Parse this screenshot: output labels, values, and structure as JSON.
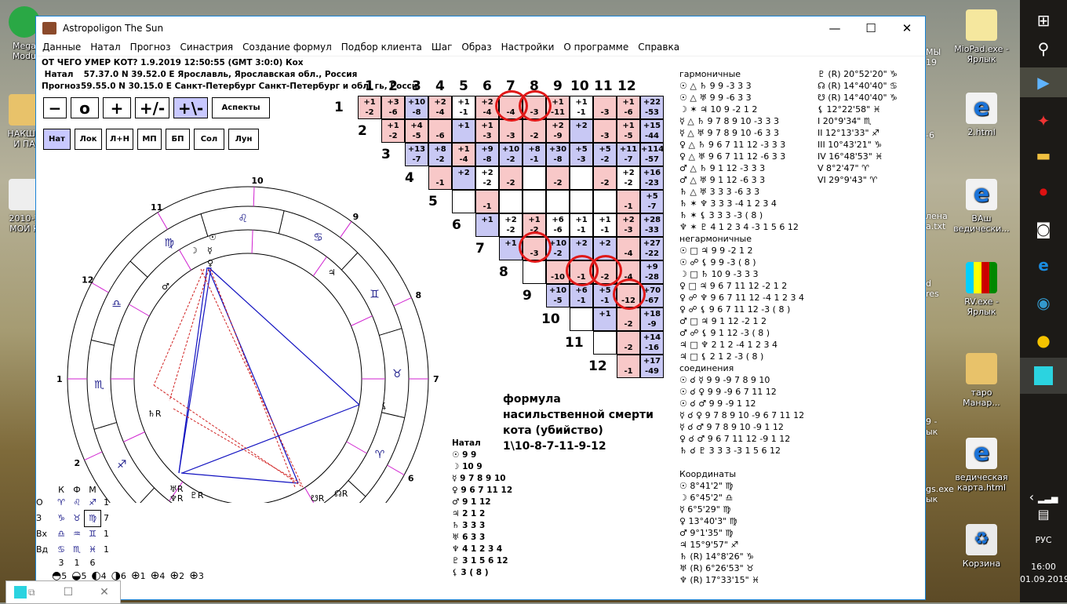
{
  "desktop": {
    "left_icons": [
      {
        "label": "Mega\nModu",
        "color": "#2aa845"
      },
      {
        "label": "НАКША\nИ ПА",
        "color": "#e8c26a"
      },
      {
        "label": "2010-2\nМОЙ К",
        "color": "#eeeeee"
      }
    ],
    "right_icons": [
      {
        "label": "MioPad.exe -\nЯрлык",
        "color": "#f5e79e"
      },
      {
        "label": "2.html",
        "color": "#f2f2f2"
      },
      {
        "label": "ВАш\nведически...",
        "color": "#f2f2f2"
      },
      {
        "label": "RV.exe -\nЯрлык",
        "color": "#d81c1c"
      },
      {
        "label": "таро\nМанар...",
        "color": "#e8c26a"
      },
      {
        "label": "ведическая\nкарта.html",
        "color": "#f2f2f2"
      },
      {
        "label": "Корзина",
        "color": "#eaeaea"
      }
    ],
    "partial_icons": [
      "МЫ\n19",
      "-6",
      "лена\na.txt",
      "d\nres",
      "9 -\nык",
      "gs.exe\nык"
    ]
  },
  "taskbar": {
    "language": "РУС",
    "time": "16:00",
    "date": "01.09.2019",
    "items": [
      "windows-start",
      "search",
      "media-player",
      "star-app",
      "file-explorer",
      "recorder",
      "camera",
      "edge",
      "astro-app-2",
      "paint",
      "astropoligon"
    ]
  },
  "window": {
    "title": "Astropoligon The Sun",
    "menu": [
      "Данные",
      "Натал",
      "Прогноз",
      "Синастрия",
      "Создание формул",
      "Подбор клиента",
      "Шаг",
      "Образ",
      "Настройки",
      "О программе",
      "Справка"
    ],
    "info": {
      "line1": "ОТ ЧЕГО УМЕР КОТ?   1.9.2019 12:50:55 (GMT 3:0:0)     Кох",
      "natal_label": "Натал",
      "natal_value": "57.37.0 N  39.52.0 E  Ярославль, Ярославская обл., Россия",
      "prognoz_label": "Прогноз",
      "prognoz_value": "59.55.0 N  30.15.0 E Санкт-Петербург Санкт-Петербург и обл. гь, Росси"
    },
    "buttons_row1": [
      {
        "label": "−",
        "active": false
      },
      {
        "label": "o",
        "active": false
      },
      {
        "label": "+",
        "active": false
      },
      {
        "label": "+/-",
        "active": false
      },
      {
        "label": "+\\-",
        "active": true
      },
      {
        "label": "Аспекты",
        "active": false
      }
    ],
    "buttons_row2": [
      {
        "label": "Нат",
        "active": true
      },
      {
        "label": "Лок",
        "active": false
      },
      {
        "label": "Л+Н",
        "active": false
      },
      {
        "label": "МП",
        "active": false
      },
      {
        "label": "БП",
        "active": false
      },
      {
        "label": "Сол",
        "active": false
      },
      {
        "label": "Лун",
        "active": false
      }
    ]
  },
  "house_grid": {
    "col_headers": [
      "1",
      "2",
      "3",
      "4",
      "5",
      "6",
      "7",
      "8",
      "9",
      "10",
      "11",
      "12"
    ],
    "row_headers": [
      "1",
      "2",
      "3",
      "4",
      "5",
      "6",
      "7",
      "8",
      "9",
      "10",
      "11",
      "12"
    ],
    "rows": [
      [
        [
          "r",
          "+1",
          "-2"
        ],
        [
          "r",
          "+3",
          "-6"
        ],
        [
          "b",
          "+10",
          "-8"
        ],
        [
          "r",
          "+2",
          "-4"
        ],
        [
          "w",
          "+1",
          "-1"
        ],
        [
          "r",
          "+2",
          "-4"
        ],
        [
          "r",
          "",
          "-4"
        ],
        [
          "r",
          "",
          "-3"
        ],
        [
          "r",
          "+1",
          "-11"
        ],
        [
          "w",
          "+1",
          "-1"
        ],
        [
          "r",
          "",
          "-3"
        ],
        [
          "r",
          "+1",
          "-6"
        ],
        [
          "b",
          "+22",
          "-53"
        ]
      ],
      [
        [
          "r",
          "+1",
          "-2"
        ],
        [
          "r",
          "+4",
          "-5"
        ],
        [
          "r",
          "",
          "-6"
        ],
        [
          "b",
          "+1",
          ""
        ],
        [
          "r",
          "+1",
          "-3"
        ],
        [
          "r",
          "",
          "-3"
        ],
        [
          "r",
          "",
          "-2"
        ],
        [
          "r",
          "+2",
          "-9"
        ],
        [
          "b",
          "+2",
          ""
        ],
        [
          "r",
          "",
          "-3"
        ],
        [
          "r",
          "+1",
          "-5"
        ],
        [
          "b",
          "+15",
          "-44"
        ]
      ],
      [
        [
          "b",
          "+13",
          "-7"
        ],
        [
          "b",
          "+8",
          "-2"
        ],
        [
          "r",
          "+1",
          "-4"
        ],
        [
          "b",
          "+9",
          "-8"
        ],
        [
          "b",
          "+10",
          "-2"
        ],
        [
          "b",
          "+8",
          "-1"
        ],
        [
          "b",
          "+30",
          "-8"
        ],
        [
          "b",
          "+5",
          "-3"
        ],
        [
          "b",
          "+5",
          "-2"
        ],
        [
          "b",
          "+11",
          "-7"
        ],
        [
          "b",
          "+114",
          "-57"
        ]
      ],
      [
        [
          "r",
          "",
          "-1"
        ],
        [
          "b",
          "+2",
          ""
        ],
        [
          "w",
          "+2",
          "-2"
        ],
        [
          "r",
          "",
          "-2"
        ],
        [
          "w",
          "",
          ""
        ],
        [
          "r",
          "",
          "-2"
        ],
        [
          "w",
          "",
          ""
        ],
        [
          "r",
          "",
          "-2"
        ],
        [
          "w",
          "+2",
          "-2"
        ],
        [
          "b",
          "+16",
          "-23"
        ]
      ],
      [
        [
          "w",
          "",
          ""
        ],
        [
          "r",
          "",
          "-1"
        ],
        [
          "w",
          "",
          ""
        ],
        [
          "w",
          "",
          ""
        ],
        [
          "w",
          "",
          ""
        ],
        [
          "w",
          "",
          ""
        ],
        [
          "w",
          "",
          ""
        ],
        [
          "r",
          "",
          "-1"
        ],
        [
          "b",
          "+5",
          "-7"
        ]
      ],
      [
        [
          "b",
          "+1",
          ""
        ],
        [
          "w",
          "+2",
          "-2"
        ],
        [
          "r",
          "+1",
          "-2"
        ],
        [
          "w",
          "+6",
          "-6"
        ],
        [
          "w",
          "+1",
          "-1"
        ],
        [
          "w",
          "+1",
          "-1"
        ],
        [
          "r",
          "+2",
          "-3"
        ],
        [
          "b",
          "+28",
          "-33"
        ]
      ],
      [
        [
          "b",
          "+1",
          ""
        ],
        [
          "r",
          "",
          "-3"
        ],
        [
          "b",
          "+10",
          "-2"
        ],
        [
          "b",
          "+2",
          ""
        ],
        [
          "b",
          "+2",
          ""
        ],
        [
          "r",
          "",
          "-4"
        ],
        [
          "b",
          "+27",
          "-22"
        ]
      ],
      [
        [
          "w",
          "",
          ""
        ],
        [
          "r",
          "",
          "-10"
        ],
        [
          "r",
          "",
          "-1"
        ],
        [
          "r",
          "",
          "-2"
        ],
        [
          "r",
          "",
          "-4"
        ],
        [
          "b",
          "+9",
          "-28"
        ]
      ],
      [
        [
          "b",
          "+10",
          "-5"
        ],
        [
          "b",
          "+6",
          "-1"
        ],
        [
          "b",
          "+5",
          "-1"
        ],
        [
          "r",
          "",
          "-12"
        ],
        [
          "b",
          "+70",
          "-67"
        ]
      ],
      [
        [
          "w",
          "",
          ""
        ],
        [
          "b",
          "+1",
          ""
        ],
        [
          "r",
          "",
          "-2"
        ],
        [
          "b",
          "+18",
          "-9"
        ]
      ],
      [
        [
          "w",
          "",
          ""
        ],
        [
          "r",
          "",
          "-2"
        ],
        [
          "b",
          "+14",
          "-16"
        ]
      ],
      [
        [
          "r",
          "",
          "-1"
        ],
        [
          "b",
          "+17",
          "-49"
        ]
      ]
    ],
    "highlighted": [
      "1-7",
      "1-8",
      "7-8",
      "8-10",
      "8-11",
      "9-12"
    ]
  },
  "formula": {
    "lines": [
      "формула",
      "насильственной смерти",
      "кота (убийство)",
      "1\\10-8-7-11-9-12"
    ]
  },
  "natal_list": {
    "title": "Натал",
    "items": [
      {
        "glyph": "☉",
        "text": "9 9"
      },
      {
        "glyph": "☽",
        "text": "10 9"
      },
      {
        "glyph": "☿",
        "text": "9 7 8 9 10"
      },
      {
        "glyph": "♀",
        "text": "9 6 7 11 12"
      },
      {
        "glyph": "♂",
        "text": "9 1 12"
      },
      {
        "glyph": "♃",
        "text": "2 1 2"
      },
      {
        "glyph": "♄",
        "text": "3 3 3"
      },
      {
        "glyph": "♅",
        "text": "6 3 3"
      },
      {
        "glyph": "♆",
        "text": "4 1 2 3 4"
      },
      {
        "glyph": "♇",
        "text": "3 1 5 6 12"
      },
      {
        "glyph": "⚸",
        "text": "3 ( 8 )"
      }
    ]
  },
  "aspects": {
    "harmonic_title": "гармоничные",
    "harmonic": [
      "☉ △ ♄  9 9  -3 3 3",
      "☉ △ ♅  9 9  -6 3 3",
      "☽ ✶ ♃  10 9  -2 1 2",
      "☿ △ ♄  9 7 8 9 10  -3 3 3",
      "☿ △ ♅  9 7 8 9 10  -6 3 3",
      "♀ △ ♄  9 6 7 11 12  -3 3 3",
      "♀ △ ♅  9 6 7 11 12  -6 3 3",
      "♂ △ ♄  9 1 12  -3 3 3",
      "♂ △ ♅  9 1 12  -6 3 3",
      "♄ △ ♅  3 3 3  -6 3 3",
      "♄ ✶ ♆  3 3 3  -4 1 2 3 4",
      "♄ ✶ ⚸  3 3 3  -3 ( 8 )",
      "♆ ✶ ♇  4 1 2 3 4  -3 1 5 6 12"
    ],
    "nonharmonic_title": "негармоничные",
    "nonharmonic": [
      "☉ □ ♃  9 9  -2 1 2",
      "☉ ☍ ⚸  9 9  -3 ( 8 )",
      "☽ □ ♄  10 9  -3 3 3",
      "♀ □ ♃  9 6 7 11 12  -2 1 2",
      "♀ ☍ ♆  9 6 7 11 12  -4 1 2 3 4",
      "♀ ☍ ⚸  9 6 7 11 12  -3 ( 8 )",
      "♂ □ ♃  9 1 12  -2 1 2",
      "♂ ☍ ⚸  9 1 12  -3 ( 8 )",
      "♃ □ ♆  2 1 2  -4 1 2 3 4",
      "♃ □ ⚸  2 1 2  -3 ( 8 )"
    ],
    "conjunction_title": "соединения",
    "conjunctions": [
      "☉ ☌ ☿  9 9  -9 7 8 9 10",
      "☉ ☌ ♀  9 9  -9 6 7 11 12",
      "☉ ☌ ♂  9 9  -9 1 12",
      "☿ ☌ ♀  9 7 8 9 10  -9 6 7 11 12",
      "☿ ☌ ♂  9 7 8 9 10  -9 1 12",
      "♀ ☌ ♂  9 6 7 11 12  -9 1 12",
      "♄ ☌ ♇  3 3 3  -3 1 5 6 12"
    ]
  },
  "coordinates": {
    "title": "Координаты",
    "items": [
      "☉ 8°41'2\" ♍",
      "☽ 6°45'2\" ♎",
      "☿ 6°5'29\" ♍",
      "♀ 13°40'3\" ♍",
      "♂ 9°1'35\" ♍",
      "♃ 15°9'57\" ♐",
      "♄ (R)  14°8'26\" ♑",
      "♅ (R)  6°26'53\" ♉",
      "♆ (R)  17°33'15\" ♓"
    ],
    "items2": [
      "♇ (R)  20°52'20\" ♑",
      "☊ (R)  14°40'40\" ♋",
      "☋ (R)  14°40'40\" ♑",
      "⚸ 12°22'58\" ♓",
      "I  20°9'34\" ♏",
      "II  12°13'33\" ♐",
      "III  10°43'21\" ♑",
      "IV  16°48'53\" ♓",
      "V  8°2'47\" ♈",
      "VI  29°9'43\" ♈"
    ]
  },
  "chart_wheel": {
    "house_numbers": [
      "1",
      "2",
      "3",
      "4",
      "5",
      "6",
      "7",
      "8",
      "9",
      "10",
      "11",
      "12"
    ],
    "signs": [
      "♏",
      "♐",
      "♑",
      "♒",
      "♓",
      "♈",
      "♉",
      "♊",
      "♋",
      "♌",
      "♍",
      "♎"
    ],
    "planets_in_chart": [
      "☉",
      "☽",
      "☿",
      "♀",
      "♂",
      "♃",
      "♄R",
      "♅R",
      "♆R",
      "♇R",
      "☊R",
      "☋R",
      "⚸"
    ]
  },
  "elements_table": {
    "headers": [
      "К",
      "Ф",
      "М"
    ],
    "rows": [
      {
        "label": "О",
        "signs": [
          "♈",
          "♌",
          "♐"
        ],
        "count": "1"
      },
      {
        "label": "З",
        "signs": [
          "♑",
          "♉",
          "♍"
        ],
        "count": "7"
      },
      {
        "label": "Вх",
        "signs": [
          "♎",
          "♒",
          "♊"
        ],
        "count": "1"
      },
      {
        "label": "Вд",
        "signs": [
          "♋",
          "♏",
          "♓"
        ],
        "count": "1"
      }
    ],
    "totals": [
      "3",
      "1",
      "6"
    ],
    "hemispheres": [
      "5",
      "5",
      "4",
      "6",
      "1",
      "4",
      "2",
      "3"
    ]
  },
  "small_window": {
    "controls": [
      "restore",
      "maximize",
      "close"
    ]
  }
}
